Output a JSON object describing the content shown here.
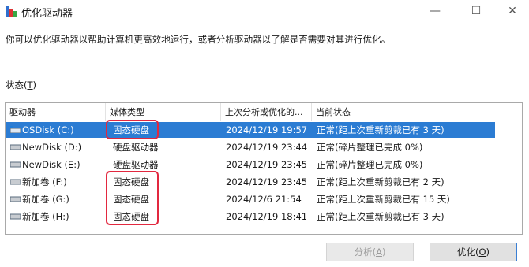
{
  "window": {
    "title": "优化驱动器",
    "minimize": "—",
    "maximize": "☐",
    "close": "✕"
  },
  "description": "你可以优化驱动器以帮助计算机更高效地运行，或者分析驱动器以了解是否需要对其进行优化。",
  "status": {
    "label": "状态",
    "accel_open": "(",
    "accel_key": "T",
    "accel_close": ")"
  },
  "columns": [
    "驱动器",
    "媒体类型",
    "上次分析或优化的...",
    "当前状态"
  ],
  "drives": [
    {
      "name": "OSDisk (C:)",
      "media": "固态硬盘",
      "last": "2024/12/19 19:57",
      "state": "正常(距上次重新剪裁已有 3 天)"
    },
    {
      "name": "NewDisk (D:)",
      "media": "硬盘驱动器",
      "last": "2024/12/19 23:44",
      "state": "正常(碎片整理已完成 0%)"
    },
    {
      "name": "NewDisk (E:)",
      "media": "硬盘驱动器",
      "last": "2024/12/19 23:45",
      "state": "正常(碎片整理已完成 0%)"
    },
    {
      "name": "新加卷 (F:)",
      "media": "固态硬盘",
      "last": "2024/12/19 23:45",
      "state": "正常(距上次重新剪裁已有 2 天)"
    },
    {
      "name": "新加卷 (G:)",
      "media": "固态硬盘",
      "last": "2024/12/6 21:54",
      "state": "正常(距上次重新剪裁已有 15 天)"
    },
    {
      "name": "新加卷 (H:)",
      "media": "固态硬盘",
      "last": "2024/12/19 18:41",
      "state": "正常(距上次重新剪裁已有 3 天)"
    }
  ],
  "buttons": {
    "analyze": {
      "label": "分析",
      "accel_open": "(",
      "accel_key": "A",
      "accel_close": ")"
    },
    "optimize": {
      "label": "优化",
      "accel_open": "(",
      "accel_key": "O",
      "accel_close": ")"
    }
  },
  "colors": {
    "selection": "#2b7cd3",
    "highlight": "#e2283f"
  }
}
